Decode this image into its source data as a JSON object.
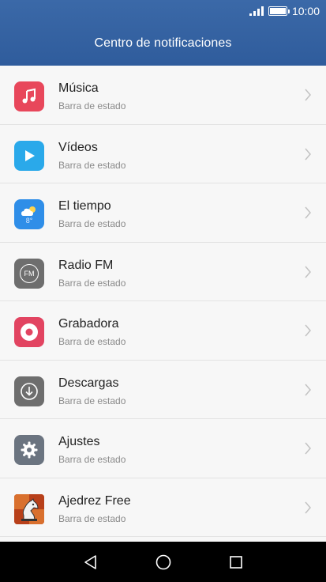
{
  "status": {
    "time": "10:00"
  },
  "header": {
    "title": "Centro de notificaciones"
  },
  "apps": [
    {
      "name": "Música",
      "subtitle": "Barra de estado",
      "icon": "music-note-icon",
      "color": "#e8475b"
    },
    {
      "name": "Vídeos",
      "subtitle": "Barra de estado",
      "icon": "play-icon",
      "color": "#2aa9ea"
    },
    {
      "name": "El tiempo",
      "subtitle": "Barra de estado",
      "icon": "weather-icon",
      "color": "#2f8ee8",
      "icon_text": "8°"
    },
    {
      "name": "Radio FM",
      "subtitle": "Barra de estado",
      "icon": "radio-fm-icon",
      "color": "#6e6e6e",
      "icon_text": "FM"
    },
    {
      "name": "Grabadora",
      "subtitle": "Barra de estado",
      "icon": "recorder-icon",
      "color": "#e24461"
    },
    {
      "name": "Descargas",
      "subtitle": "Barra de estado",
      "icon": "download-icon",
      "color": "#6e6e6e"
    },
    {
      "name": "Ajustes",
      "subtitle": "Barra de estado",
      "icon": "gear-icon",
      "color": "#6b7480"
    },
    {
      "name": "Ajedrez Free",
      "subtitle": "Barra de estado",
      "icon": "chess-knight-icon",
      "color": "#c8481b"
    }
  ],
  "navbar": {
    "back": "back-icon",
    "home": "home-icon",
    "recents": "recents-icon"
  }
}
